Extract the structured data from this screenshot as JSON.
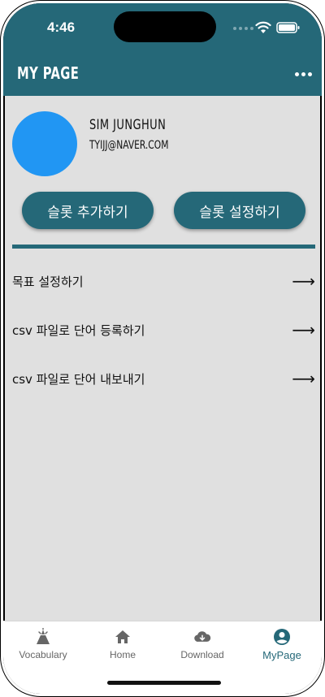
{
  "status_bar": {
    "time": "4:46"
  },
  "app_bar": {
    "title": "MY PAGE",
    "more_icon": "more-horizontal-icon"
  },
  "profile": {
    "name": "SIM JUNGHUN",
    "email": "TYIJJ@NAVER.COM",
    "avatar_color": "#2196f3"
  },
  "actions": {
    "add_slot_label": "슬롯 추가하기",
    "set_slot_label": "슬롯 설정하기"
  },
  "menu": [
    {
      "label": "목표 설정하기",
      "arrow": "⟶"
    },
    {
      "label": "csv 파일로 단어 등록하기",
      "arrow": "⟶"
    },
    {
      "label": "csv 파일로 단어 내보내기",
      "arrow": "⟶"
    }
  ],
  "bottom_nav": [
    {
      "label": "Vocabulary",
      "icon": "vocabulary-icon"
    },
    {
      "label": "Home",
      "icon": "home-icon"
    },
    {
      "label": "Download",
      "icon": "cloud-download-icon"
    },
    {
      "label": "MyPage",
      "icon": "account-circle-icon",
      "active": true
    }
  ],
  "colors": {
    "primary": "#256878",
    "background": "#e0e0e0",
    "avatar": "#2196f3"
  }
}
